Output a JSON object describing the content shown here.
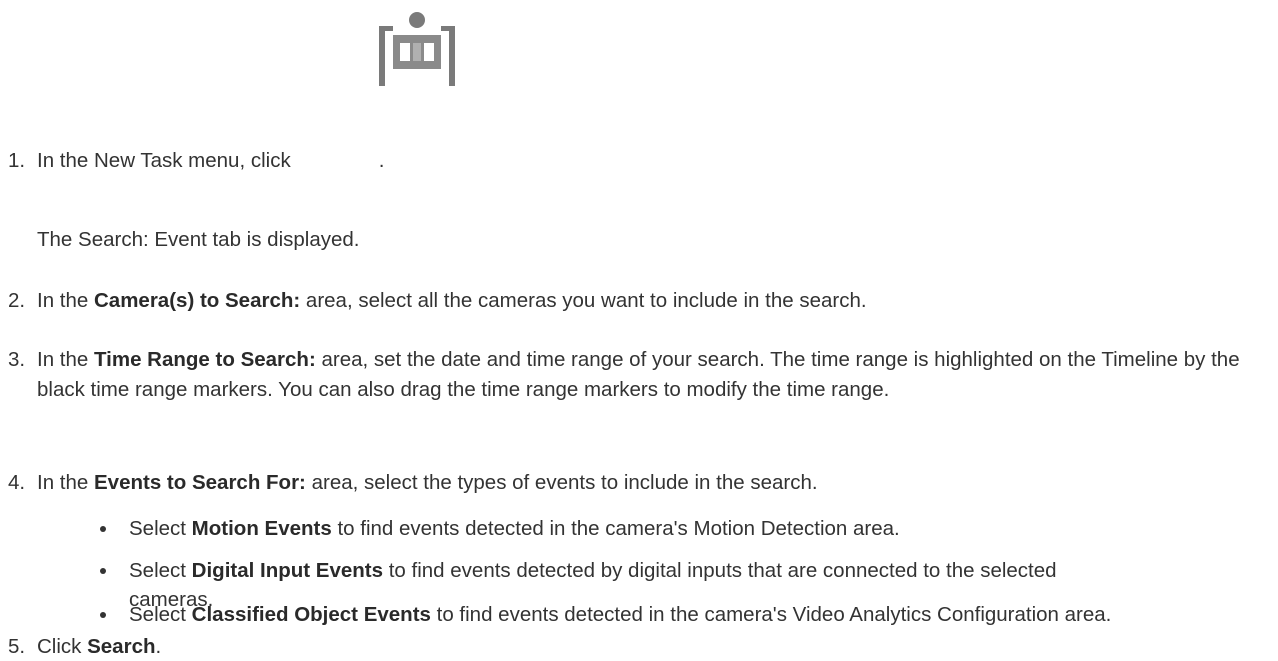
{
  "steps": [
    {
      "num": "1.",
      "pre": "In the New Task menu, click",
      "post": "."
    },
    {
      "sub": "The Search: Event tab is displayed."
    },
    {
      "num": "2.",
      "pre": "In the ",
      "bold": "Camera(s) to Search:",
      "post": " area, select all the cameras you want to include in the search."
    },
    {
      "num": "3.",
      "pre": "In the ",
      "bold": "Time Range to Search:",
      "post": " area, set the date and time range of your search. The time range is highlighted on the Timeline by the black time range markers. You can also drag the time range markers to modify the time range."
    },
    {
      "num": "4.",
      "pre": "In the ",
      "bold": "Events to Search For:",
      "post": " area, select the types of events to include in the search."
    },
    {
      "num": "5.",
      "pre": "Click ",
      "bold": "Search",
      "post": "."
    }
  ],
  "bullets": [
    {
      "pre": "Select ",
      "bold": "Motion Events",
      "post": " to find events detected in the camera's Motion Detection area."
    },
    {
      "pre": "Select ",
      "bold": "Digital Input Events",
      "post": " to find events detected by digital inputs that are connected to the selected cameras."
    },
    {
      "pre": "Select ",
      "bold": "Classified Object Events",
      "post": " to find events detected in the camera's Video Analytics Configuration area."
    }
  ],
  "icons": {
    "new_task_event_search": "event-search-icon"
  }
}
